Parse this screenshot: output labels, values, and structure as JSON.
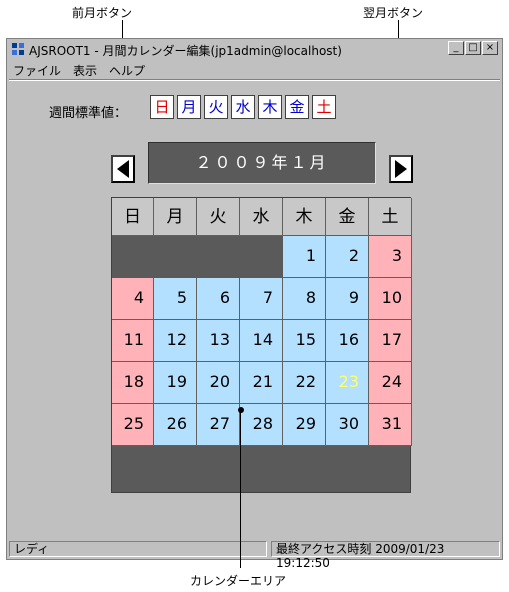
{
  "annotations": {
    "prev_month_button": "前月ボタン",
    "next_month_button": "翌月ボタン",
    "calendar_area": "カレンダーエリア"
  },
  "window": {
    "title": "AJSROOT1 - 月間カレンダー編集(jp1admin@localhost)",
    "minimize": "_",
    "maximize": "□",
    "close": "×"
  },
  "menu": [
    "ファイル",
    "表示",
    "ヘルプ"
  ],
  "week_standard": {
    "label": "週間標準値：",
    "days": [
      "日",
      "月",
      "火",
      "水",
      "木",
      "金",
      "土"
    ]
  },
  "month_label": "２００９年１月",
  "calendar": {
    "headers": [
      "日",
      "月",
      "火",
      "水",
      "木",
      "金",
      "土"
    ],
    "rows": [
      [
        "",
        "",
        "",
        "",
        "1",
        "2",
        "3"
      ],
      [
        "4",
        "5",
        "6",
        "7",
        "8",
        "9",
        "10"
      ],
      [
        "11",
        "12",
        "13",
        "14",
        "15",
        "16",
        "17"
      ],
      [
        "18",
        "19",
        "20",
        "21",
        "22",
        "23",
        "24"
      ],
      [
        "25",
        "26",
        "27",
        "28",
        "29",
        "30",
        "31"
      ]
    ]
  },
  "status": {
    "left": "レディ",
    "right": "最終アクセス時刻 2009/01/23 19:12:50"
  },
  "colors": {
    "workday": "#b3e0ff",
    "holiday": "#ffb3b8",
    "empty": "#5a5a5a",
    "highlight_text": "#ffff66",
    "sunday_text": "#e00000",
    "weekday_text": "#0000d0"
  }
}
